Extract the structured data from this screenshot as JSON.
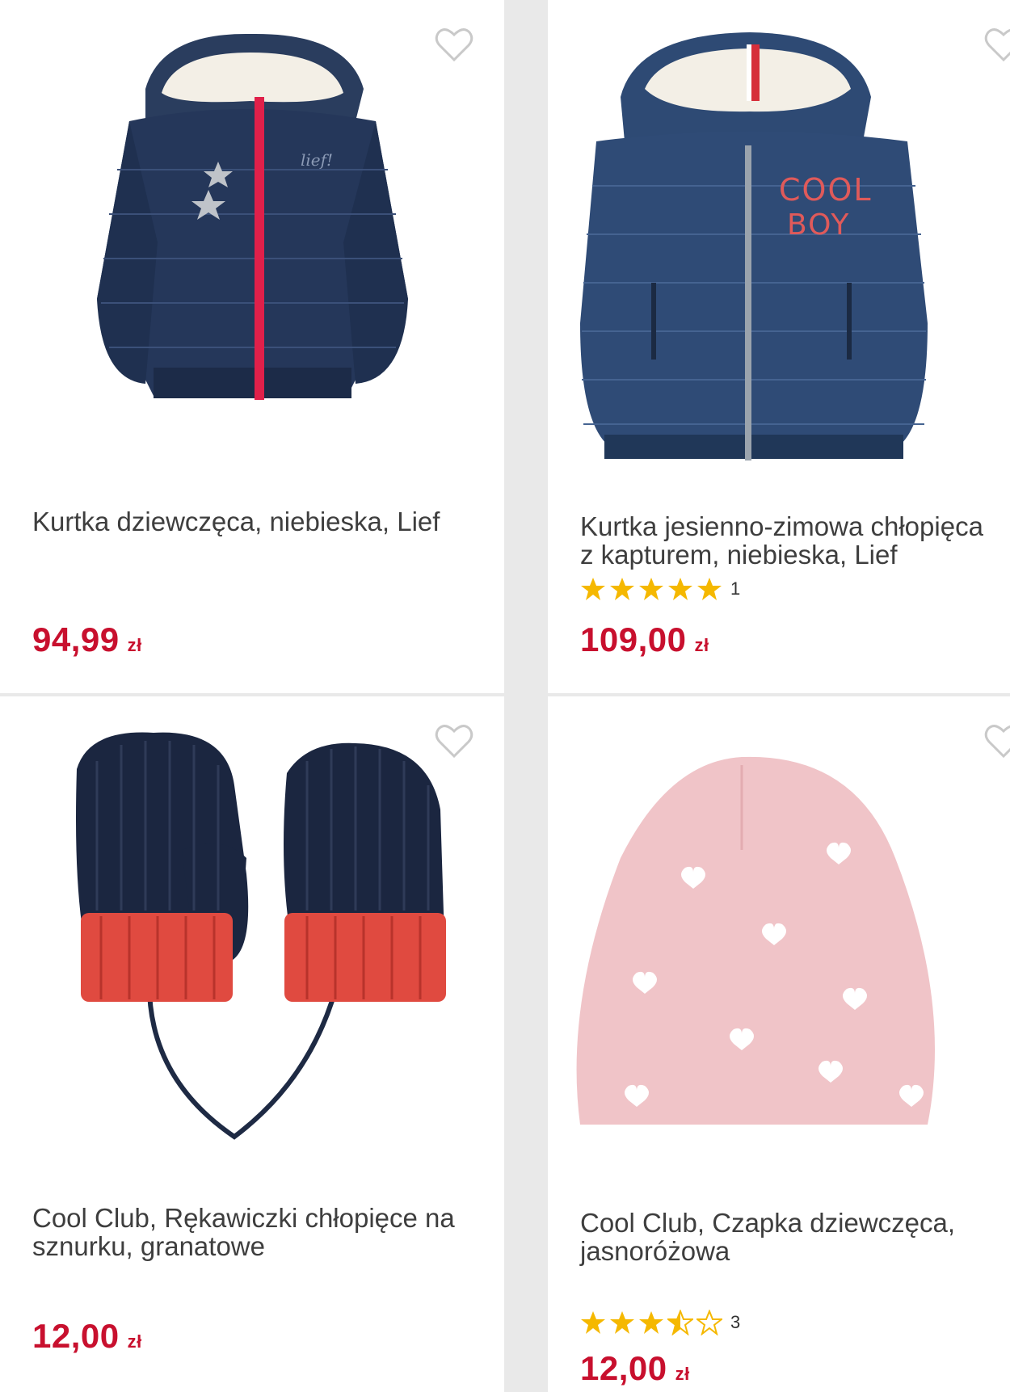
{
  "colors": {
    "price": "#c8102e",
    "star": "#f5b800",
    "heart_outline": "#c9c9c9",
    "background": "#e9e9e9"
  },
  "products": [
    {
      "title": "Kurtka dziewczęca, niebieska, Lief",
      "price": "94,99",
      "currency": "zł",
      "rating": null,
      "reviews": null,
      "icon": "heart-outline-icon"
    },
    {
      "title": "Kurtka jesienno-zimowa chłopięca z kapturem, niebieska, Lief",
      "price": "109,00",
      "currency": "zł",
      "rating": 5,
      "reviews": "1",
      "icon": "heart-outline-icon"
    },
    {
      "title": "Cool Club, Rękawiczki chłopięce na sznurku, granatowe",
      "price": "12,00",
      "currency": "zł",
      "rating": null,
      "reviews": null,
      "icon": "heart-outline-icon"
    },
    {
      "title": "Cool Club, Czapka dziewczęca, jasnoróżowa",
      "price": "12,00",
      "currency": "zł",
      "rating": 3.5,
      "reviews": "3",
      "icon": "heart-outline-icon"
    }
  ]
}
